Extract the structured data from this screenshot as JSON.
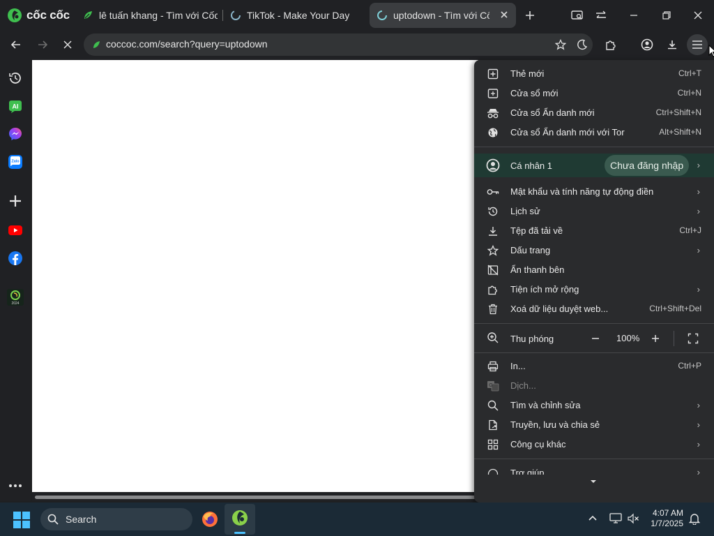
{
  "brand": {
    "name": "cốc cốc"
  },
  "tabs": [
    {
      "title": "lê tuấn khang - Tìm với Cốc Cốc"
    },
    {
      "title": "TikTok - Make Your Day"
    },
    {
      "title": "uptodown - Tìm với Cốc Cốc"
    }
  ],
  "address_bar": {
    "url": "coccoc.com/search?query=uptodown"
  },
  "menu": {
    "top_items": [
      {
        "label": "Thẻ mới",
        "shortcut": "Ctrl+T"
      },
      {
        "label": "Cửa sổ mới",
        "shortcut": "Ctrl+N"
      },
      {
        "label": "Cửa sổ Ẩn danh mới",
        "shortcut": "Ctrl+Shift+N"
      },
      {
        "label": "Cửa sổ Ẩn danh mới với Tor",
        "shortcut": "Alt+Shift+N"
      }
    ],
    "profile": {
      "label": "Cá nhân 1",
      "status": "Chưa đăng nhập"
    },
    "mid_items": [
      {
        "label": "Mật khẩu và tính năng tự động điền",
        "shortcut": ""
      },
      {
        "label": "Lịch sử",
        "shortcut": ""
      },
      {
        "label": "Tệp đã tải về",
        "shortcut": "Ctrl+J"
      },
      {
        "label": "Dấu trang",
        "shortcut": ""
      },
      {
        "label": "Ẩn thanh bên",
        "shortcut": ""
      },
      {
        "label": "Tiện ích mở rộng",
        "shortcut": ""
      },
      {
        "label": "Xoá dữ liệu duyệt web...",
        "shortcut": "Ctrl+Shift+Del"
      }
    ],
    "zoom": {
      "label": "Thu phóng",
      "value": "100%"
    },
    "bottom_items": [
      {
        "label": "In...",
        "shortcut": "Ctrl+P"
      },
      {
        "label": "Dịch...",
        "shortcut": ""
      },
      {
        "label": "Tìm và chỉnh sửa",
        "shortcut": ""
      },
      {
        "label": "Truyền, lưu và chia sẻ",
        "shortcut": ""
      },
      {
        "label": "Công cụ khác",
        "shortcut": ""
      },
      {
        "label": "Trợ giúp",
        "shortcut": ""
      }
    ]
  },
  "taskbar": {
    "search_label": "Search",
    "time": "4:07 AM",
    "date": "1/7/2025"
  },
  "colors": {
    "accent": "#1a9b3c",
    "brand_green": "#2ec24b",
    "profile_bg": "#1f3a33"
  }
}
